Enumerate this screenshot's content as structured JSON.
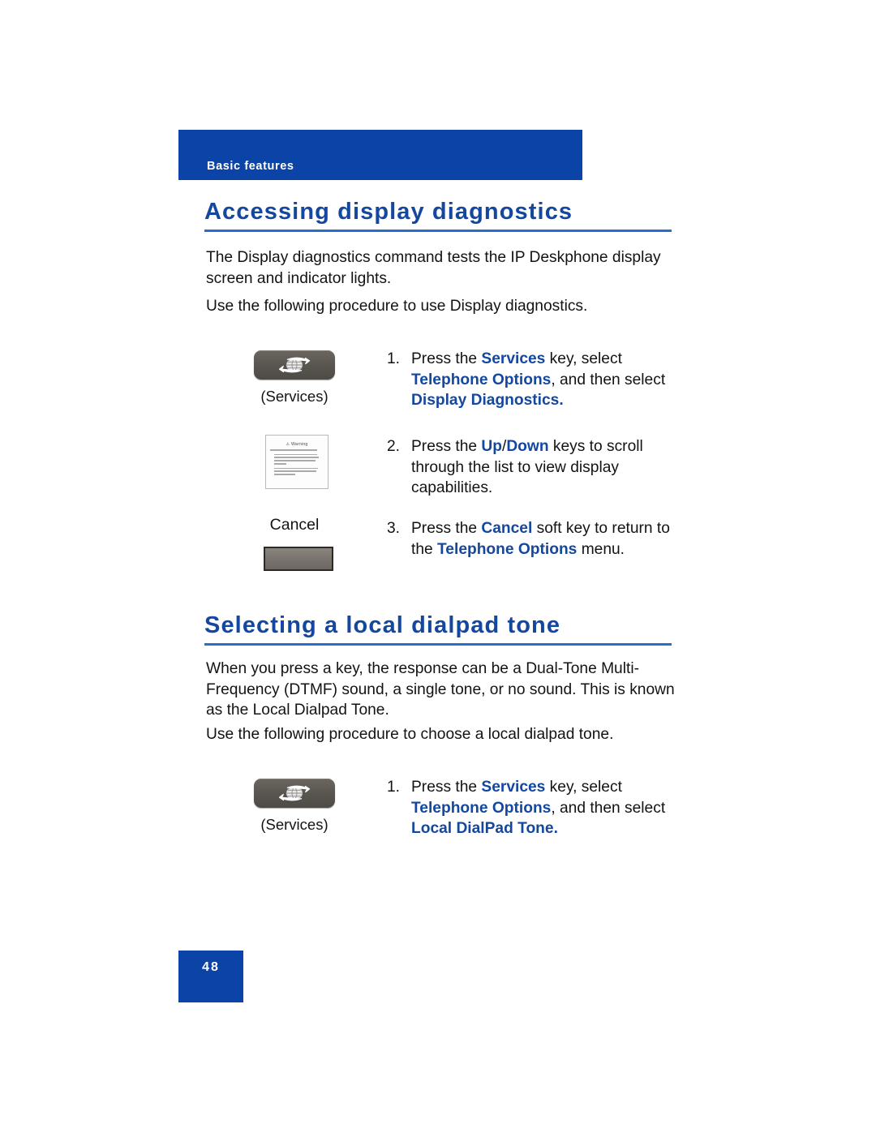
{
  "header": {
    "running_title": "Basic features"
  },
  "sections": [
    {
      "heading": "Accessing display diagnostics",
      "paragraphs": [
        "The Display diagnostics command tests the IP Deskphone display screen and indicator lights.",
        "Use the following procedure to use Display diagnostics."
      ],
      "steps": [
        {
          "number": "1.",
          "text_parts": [
            {
              "t": "Press the ",
              "bold": false
            },
            {
              "t": "Services",
              "bold": true
            },
            {
              "t": " key, select ",
              "bold": false
            },
            {
              "t": "Telephone Options",
              "bold": true
            },
            {
              "t": ", and then select ",
              "bold": false
            },
            {
              "t": "Display Diagnostics.",
              "bold": true
            }
          ],
          "graphic": "services-key",
          "graphic_caption": "(Services)"
        },
        {
          "number": "2.",
          "text_parts": [
            {
              "t": "Press the ",
              "bold": false
            },
            {
              "t": "Up",
              "bold": true
            },
            {
              "t": "/",
              "bold": false
            },
            {
              "t": "Down",
              "bold": true
            },
            {
              "t": " keys to scroll through the list to view display capabilities.",
              "bold": false
            }
          ],
          "graphic": "page-thumbnail",
          "graphic_caption": ""
        },
        {
          "number": "3.",
          "text_parts": [
            {
              "t": "Press the ",
              "bold": false
            },
            {
              "t": "Cancel",
              "bold": true
            },
            {
              "t": " soft key to return to the ",
              "bold": false
            },
            {
              "t": "Telephone Options",
              "bold": true
            },
            {
              "t": " menu.",
              "bold": false
            }
          ],
          "graphic": "soft-key",
          "graphic_caption": "Cancel"
        }
      ]
    },
    {
      "heading": "Selecting a local dialpad tone",
      "paragraphs": [
        "When you press a key, the response can be a Dual-Tone Multi-Frequency (DTMF) sound, a single tone, or no sound. This is known as the Local Dialpad Tone.",
        "Use the following procedure to choose a local dialpad tone."
      ],
      "steps": [
        {
          "number": "1.",
          "text_parts": [
            {
              "t": "Press the ",
              "bold": false
            },
            {
              "t": "Services",
              "bold": true
            },
            {
              "t": " key, select ",
              "bold": false
            },
            {
              "t": "Telephone Options",
              "bold": true
            },
            {
              "t": ", and then select ",
              "bold": false
            },
            {
              "t": "Local DialPad Tone.",
              "bold": true
            }
          ],
          "graphic": "services-key",
          "graphic_caption": "(Services)"
        }
      ]
    }
  ],
  "thumbnail": {
    "title": "Warning",
    "alt": "miniature scanned warning page"
  },
  "footer": {
    "page_number": "48"
  },
  "colors": {
    "brand_blue": "#0b43a6",
    "heading_blue": "#14479e",
    "rule_blue": "#2a6ecd",
    "body_text": "#131313",
    "key_gray": "#5a5650"
  }
}
